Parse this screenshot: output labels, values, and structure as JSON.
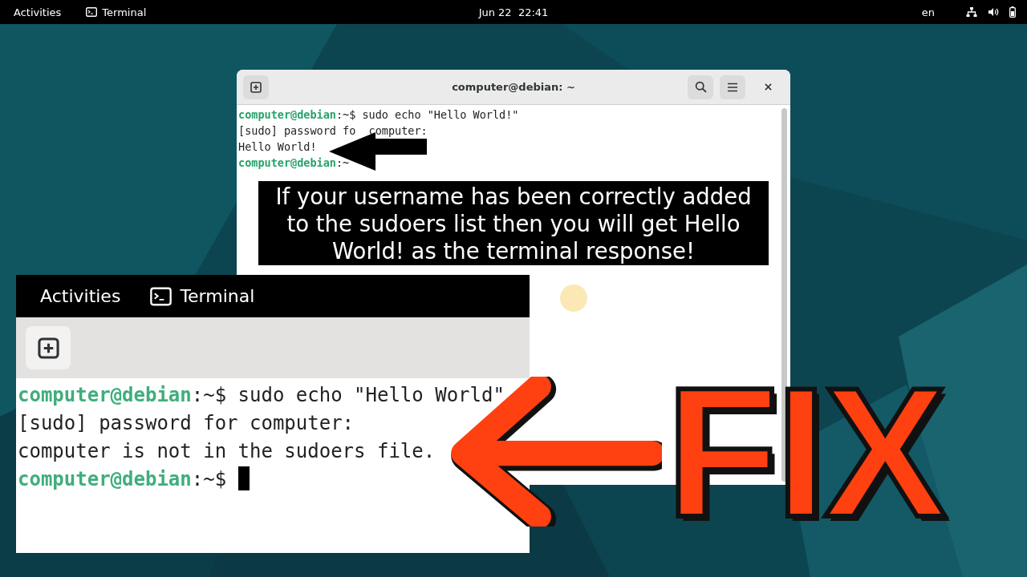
{
  "top_bar": {
    "activities": "Activities",
    "app": "Terminal",
    "clock": "Jun 22  22:41",
    "keyboard_layout": "en"
  },
  "terminal_window": {
    "title": "computer@debian: ~",
    "lines": [
      {
        "segments": [
          {
            "kind": "prompt",
            "text": "computer@debian"
          },
          {
            "kind": "plain",
            "text": ":~$ sudo echo \"Hello World!\""
          }
        ]
      },
      {
        "segments": [
          {
            "kind": "plain",
            "text": "[sudo] password fo"
          },
          {
            "kind": "after_gap",
            "text": "computer:"
          }
        ]
      },
      {
        "segments": [
          {
            "kind": "plain",
            "text": "Hello World!"
          }
        ]
      },
      {
        "segments": [
          {
            "kind": "prompt",
            "text": "computer@debian"
          },
          {
            "kind": "plain",
            "text": ":~"
          }
        ]
      }
    ]
  },
  "caption": "If your username has been correctly added to the sudoers list then you will get Hello World! as the terminal response!",
  "zoom_inset": {
    "activities": "Activities",
    "app": "Terminal",
    "lines": [
      {
        "segments": [
          {
            "kind": "prompt",
            "text": "computer@debian"
          },
          {
            "kind": "plain",
            "text": ":~$ sudo echo \"Hello World\""
          }
        ]
      },
      {
        "segments": [
          {
            "kind": "plain",
            "text": "[sudo] password for computer:"
          }
        ]
      },
      {
        "segments": [
          {
            "kind": "plain",
            "text": "computer is not in the sudoers file."
          }
        ]
      },
      {
        "segments": [
          {
            "kind": "prompt",
            "text": "computer@debian"
          },
          {
            "kind": "plain",
            "text": ":~$ "
          },
          {
            "kind": "cursor"
          }
        ]
      }
    ]
  },
  "headline": "FIX"
}
